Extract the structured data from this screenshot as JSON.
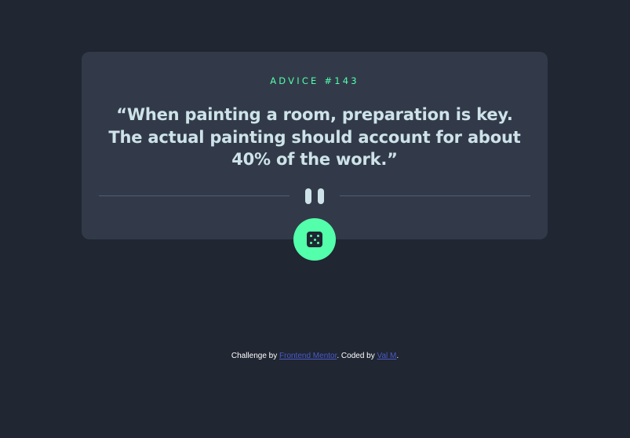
{
  "card": {
    "advice_label": "ADVICE #143",
    "quote": "“When painting a room, preparation is key. The actual painting should account for about 40% of the work.”"
  },
  "divider": {
    "icon": "pause-icon"
  },
  "dice_button": {
    "icon": "dice-icon"
  },
  "footer": {
    "prefix": "Challenge by ",
    "link1": "Frontend Mentor",
    "middle": ". Coded by ",
    "link2": "Val M",
    "suffix": "."
  },
  "colors": {
    "background": "#202632",
    "card": "#323a49",
    "accent": "#53ffaa",
    "text": "#cee3e9",
    "link": "#4a5bc7"
  }
}
